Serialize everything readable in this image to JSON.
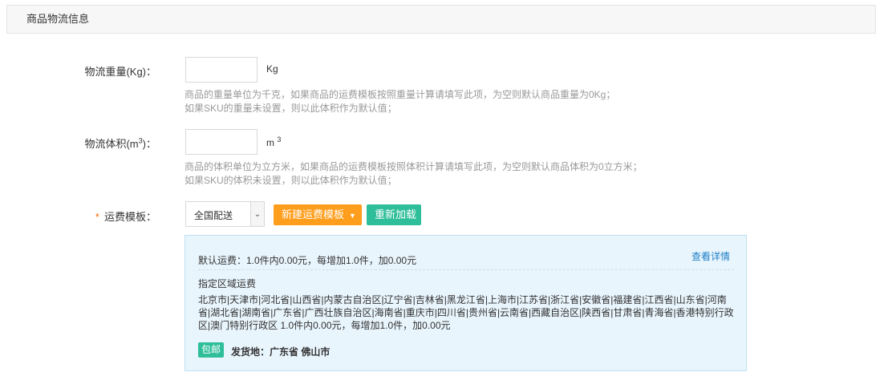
{
  "header": {
    "title": "商品物流信息"
  },
  "weight": {
    "label": "物流重量(Kg)：",
    "value": "",
    "unit": "Kg",
    "hint_line1": "商品的重量单位为千克，如果商品的运费模板按照重量计算请填写此项，为空则默认商品重量为0Kg；",
    "hint_line2": "如果SKU的重量未设置，则以此体积作为默认值；"
  },
  "volume": {
    "label_prefix": "物流体积(m",
    "label_sup": "3",
    "label_suffix": ")：",
    "value": "",
    "unit": "m",
    "unit_sup": "3",
    "hint_line1": "商品的体积单位为立方米，如果商品的运费模板按照体积计算请填写此项，为空则默认商品体积为0立方米；",
    "hint_line2": "如果SKU的体积未设置，则以此体积作为默认值；"
  },
  "template": {
    "required_mark": "*",
    "label": "运费模板：",
    "selected": "全国配送",
    "new_button": "新建运费模板",
    "reload_button": "重新加载"
  },
  "fee_info": {
    "default_fee": "默认运费：1.0件内0.00元，每增加1.0件，加0.00元",
    "detail_link": "查看详情",
    "region_title": "指定区域运费",
    "region_text": "北京市|天津市|河北省|山西省|内蒙古自治区|辽宁省|吉林省|黑龙江省|上海市|江苏省|浙江省|安徽省|福建省|江西省|山东省|河南省|湖北省|湖南省|广东省|广西壮族自治区|海南省|重庆市|四川省|贵州省|云南省|西藏自治区|陕西省|甘肃省|青海省|香港特别行政区|澳门特别行政区 1.0件内0.00元，每增加1.0件，加0.00元",
    "free_badge": "包邮",
    "ship_from": "发货地：广东省 佛山市"
  },
  "colors": {
    "accent_orange": "#ff9d1c",
    "accent_green": "#2fbe9a",
    "link_blue": "#1c7ec6",
    "info_bg": "#e9f5fd",
    "required": "#ff6a00"
  },
  "icons": {
    "select_arrow": "chevron-down-icon",
    "button_caret": "caret-down-icon"
  }
}
